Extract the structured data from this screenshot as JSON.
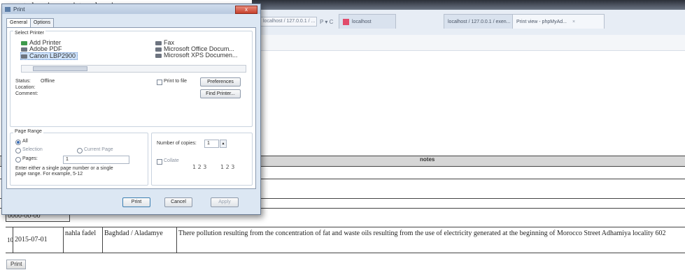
{
  "intro_text": "report showing registered regions",
  "browser": {
    "address_text": "localhost / 127.0.0.1 / ...",
    "address_icons": "P ▾ C",
    "tabs": [
      {
        "label": "localhost"
      },
      {
        "label": "localhost / 127.0.0.1 / exen..."
      },
      {
        "label": "Print view - phpMyAd..."
      }
    ]
  },
  "table": {
    "notes_header": "notes",
    "row_prev_date": "0000-00-00",
    "last_row": {
      "id": "10",
      "date": "2015-07-01",
      "name": "nahla fadel",
      "location": "Baghdad / Aladamye",
      "notes": "There pollution resulting from the concentration of fat and waste oils resulting from the use of electricity generated at the beginning of Morocco Street Adhamiya locality 602"
    }
  },
  "print_button": "Print",
  "dialog": {
    "title": "Print",
    "close": "x",
    "tabs": [
      "General",
      "Options"
    ],
    "select_printer_label": "Select Printer",
    "printers_left": [
      "Add Printer",
      "Adobe PDF",
      "Canon LBP2900"
    ],
    "printers_right": [
      "Fax",
      "Microsoft Office Docum...",
      "Microsoft XPS Documen..."
    ],
    "status_label": "Status:",
    "status_value": "Offline",
    "location_label": "Location:",
    "comment_label": "Comment:",
    "print_to_file": "Print to file",
    "preferences": "Preferences",
    "find_printer": "Find Printer...",
    "page_range_label": "Page Range",
    "range_all": "All",
    "range_selection": "Selection",
    "range_current": "Current Page",
    "range_pages": "Pages:",
    "pages_value": "1",
    "range_hint": "Enter either a single page number or a single page range. For example, 5-12",
    "copies_label": "Number of copies:",
    "copies_value": "1",
    "collate_label": "Collate",
    "collate_glyph_a": "1 2 3",
    "collate_glyph_b": "1 2 3",
    "buttons": {
      "print": "Print",
      "cancel": "Cancel",
      "apply": "Apply"
    }
  }
}
